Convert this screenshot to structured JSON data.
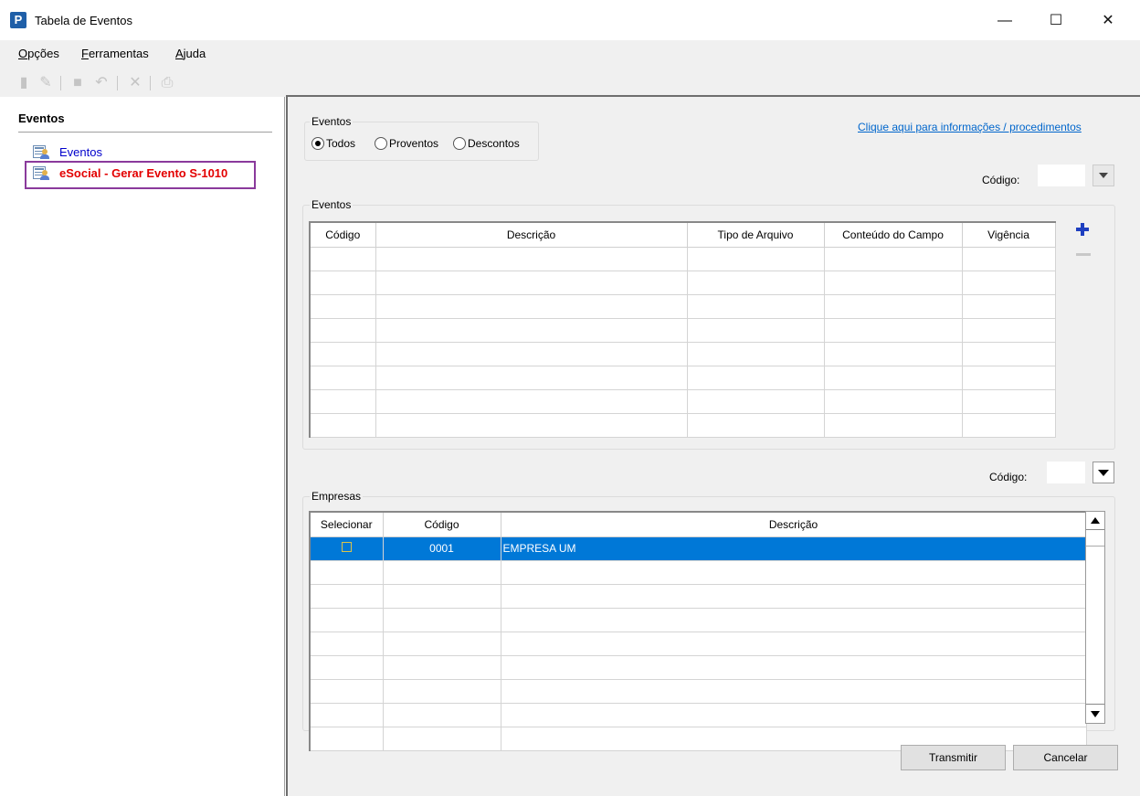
{
  "window": {
    "title": "Tabela de Eventos",
    "app_icon": "P",
    "minimize": "—",
    "maximize": "☐",
    "close": "✕"
  },
  "menu": [
    {
      "prefix": "",
      "underline": "O",
      "rest": "pções"
    },
    {
      "prefix": "",
      "underline": "F",
      "rest": "erramentas"
    },
    {
      "prefix": "",
      "underline": "A",
      "rest": "juda"
    }
  ],
  "toolbar": {
    "icons": [
      "new-document-icon",
      "edit-icon",
      "save-icon",
      "undo-icon",
      "delete-icon",
      "print-icon"
    ],
    "glyphs": [
      "▮",
      "✎",
      "■",
      "↶",
      "✕",
      "⎙"
    ]
  },
  "left_panel": {
    "title": "Eventos",
    "items": [
      {
        "label": "Eventos"
      },
      {
        "label": "eSocial - Gerar Evento S-1010"
      }
    ]
  },
  "filter": {
    "group_label": "Eventos",
    "options": [
      "Todos",
      "Proventos",
      "Descontos"
    ],
    "selected": "Todos"
  },
  "info_link": "Clique aqui para informações / procedimentos",
  "codigo_label": "Código:",
  "eventos_grid": {
    "group_label": "Eventos",
    "columns": [
      "Código",
      "Descrição",
      "Tipo de Arquivo",
      "Conteúdo do Campo",
      "Vigência"
    ],
    "add_glyph": "+",
    "row_count": 8
  },
  "empresas_grid": {
    "group_label": "Empresas",
    "columns": [
      "Selecionar",
      "Código",
      "Descrição"
    ],
    "rows": [
      {
        "codigo": "0001",
        "descricao": "EMPRESA UM",
        "selected": true
      }
    ],
    "empty_rows": 8
  },
  "buttons": {
    "transmitir": "Transmitir",
    "cancelar": "Cancelar"
  },
  "colors": {
    "selection": "#0078d7",
    "link": "#0066cc",
    "highlight_border": "#8a3a9c",
    "esocial_text": "#e30000"
  }
}
